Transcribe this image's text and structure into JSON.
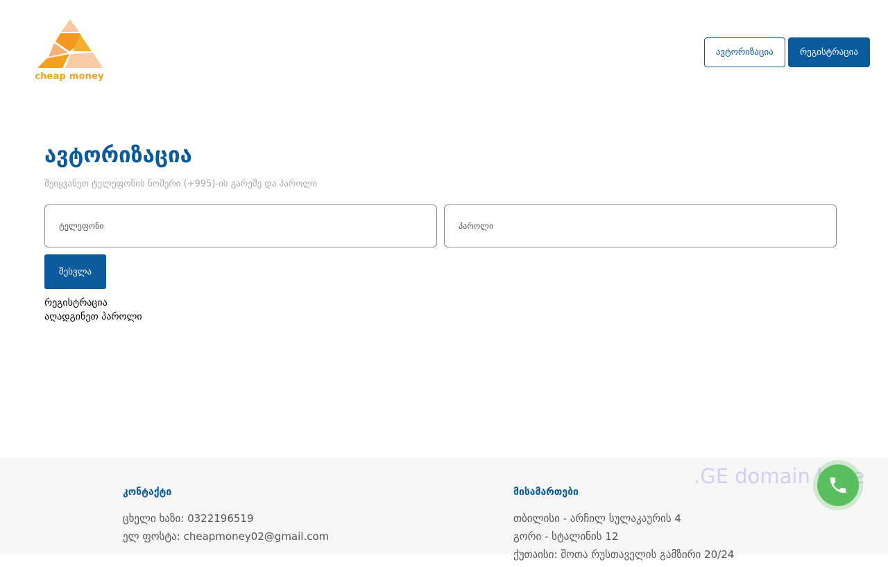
{
  "header": {
    "logo_text": "cheap money",
    "login_label": "ავტორიზაცია",
    "register_label": "რეგისტრაცია"
  },
  "main": {
    "title": "ავტორიზაცია",
    "subtitle": "შეიყვანეთ ტელეფონის ნომერი (+995)-ის გარეშე და პაროლი",
    "phone_placeholder": "ტელეფონი",
    "phone_value": "",
    "password_placeholder": "პაროლი",
    "password_value": "",
    "submit_label": "შესვლა",
    "register_link": "რეგისტრაცია",
    "recover_link": "აღადგინეთ პაროლი"
  },
  "footer": {
    "contacts_heading": "კონტაქტი",
    "hotline": "ცხელი ხაზი: 0322196519",
    "email": "ელ ფოსტა: cheapmoney02@gmail.com",
    "addresses_heading": "მისამართები",
    "addresses": [
      "თბილისი - არჩილ სულაკაურის 4",
      "გორი - სტალინის 12",
      "ქუთაისი: შოთა რუსთაველის გამზირი 20/24"
    ]
  },
  "watermark": ".GE domain base",
  "icons": {
    "call": "phone-icon"
  },
  "colors": {
    "brand_blue": "#0a5a9c",
    "logo_orange": "#f0a21f",
    "call_green": "#5cbf5f"
  }
}
